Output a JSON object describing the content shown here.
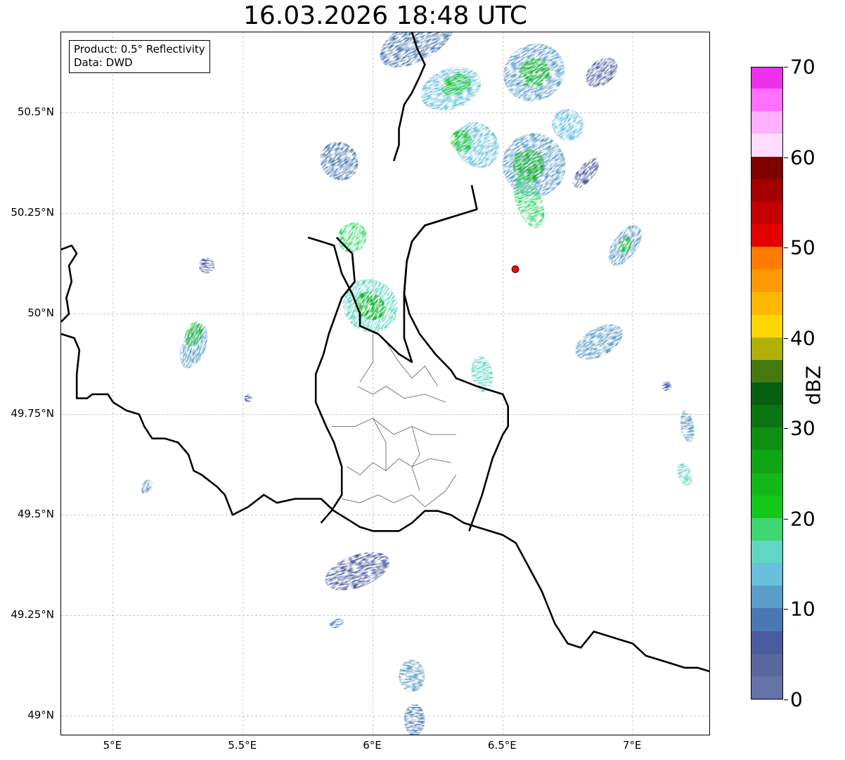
{
  "title": "16.03.2026 18:48 UTC",
  "info_box": {
    "product": "Product: 0.5° Reflectivity",
    "data": "Data: DWD"
  },
  "map": {
    "extent": {
      "lon_min": 4.8,
      "lon_max": 7.3,
      "lat_min": 48.95,
      "lat_max": 50.7
    },
    "lon_ticks": [
      {
        "value": 5.0,
        "label": "5°E"
      },
      {
        "value": 5.5,
        "label": "5.5°E"
      },
      {
        "value": 6.0,
        "label": "6°E"
      },
      {
        "value": 6.5,
        "label": "6.5°E"
      },
      {
        "value": 7.0,
        "label": "7°E"
      }
    ],
    "lat_ticks": [
      {
        "value": 50.5,
        "label": "50.5°N"
      },
      {
        "value": 50.25,
        "label": "50.25°N"
      },
      {
        "value": 50.0,
        "label": "50°N"
      },
      {
        "value": 49.75,
        "label": "49.75°N"
      },
      {
        "value": 49.5,
        "label": "49.5°N"
      },
      {
        "value": 49.25,
        "label": "49.25°N"
      },
      {
        "value": 49.0,
        "label": "49°N"
      }
    ],
    "radar_site": {
      "lon": 6.548,
      "lat": 50.111,
      "color": "#ff0000"
    },
    "country_borders": [
      [
        [
          4.8,
          50.16
        ],
        [
          4.84,
          50.17
        ],
        [
          4.86,
          50.15
        ],
        [
          4.83,
          50.12
        ],
        [
          4.84,
          50.08
        ],
        [
          4.82,
          50.04
        ],
        [
          4.83,
          50.0
        ],
        [
          4.8,
          49.98
        ]
      ],
      [
        [
          4.8,
          49.95
        ],
        [
          4.85,
          49.94
        ],
        [
          4.87,
          49.91
        ],
        [
          4.86,
          49.85
        ],
        [
          4.86,
          49.79
        ],
        [
          4.9,
          49.79
        ],
        [
          4.92,
          49.8
        ],
        [
          4.98,
          49.8
        ],
        [
          5.0,
          49.78
        ],
        [
          5.05,
          49.76
        ],
        [
          5.1,
          49.75
        ],
        [
          5.12,
          49.72
        ],
        [
          5.15,
          49.69
        ],
        [
          5.2,
          49.69
        ],
        [
          5.25,
          49.68
        ],
        [
          5.29,
          49.65
        ],
        [
          5.31,
          49.61
        ],
        [
          5.34,
          49.6
        ],
        [
          5.4,
          49.57
        ],
        [
          5.43,
          49.55
        ],
        [
          5.46,
          49.5
        ],
        [
          5.52,
          49.52
        ],
        [
          5.58,
          49.55
        ],
        [
          5.63,
          49.53
        ],
        [
          5.7,
          49.54
        ],
        [
          5.76,
          49.54
        ],
        [
          5.8,
          49.54
        ],
        [
          5.85,
          49.51
        ],
        [
          5.9,
          49.49
        ],
        [
          5.95,
          49.47
        ],
        [
          6.0,
          49.46
        ],
        [
          6.05,
          49.46
        ],
        [
          6.1,
          49.46
        ],
        [
          6.15,
          49.48
        ],
        [
          6.2,
          49.51
        ],
        [
          6.25,
          49.51
        ],
        [
          6.3,
          49.5
        ],
        [
          6.35,
          49.48
        ],
        [
          6.4,
          49.47
        ],
        [
          6.45,
          49.46
        ],
        [
          6.5,
          49.45
        ],
        [
          6.55,
          49.43
        ],
        [
          6.6,
          49.37
        ],
        [
          6.65,
          49.31
        ],
        [
          6.7,
          49.23
        ],
        [
          6.75,
          49.18
        ],
        [
          6.8,
          49.17
        ],
        [
          6.85,
          49.21
        ],
        [
          6.9,
          49.2
        ],
        [
          6.95,
          49.19
        ],
        [
          7.0,
          49.18
        ],
        [
          7.05,
          49.15
        ],
        [
          7.1,
          49.14
        ],
        [
          7.15,
          49.13
        ],
        [
          7.2,
          49.12
        ],
        [
          7.25,
          49.12
        ],
        [
          7.3,
          49.11
        ]
      ],
      [
        [
          6.38,
          50.32
        ],
        [
          6.4,
          50.26
        ],
        [
          6.3,
          50.24
        ],
        [
          6.2,
          50.22
        ],
        [
          6.15,
          50.18
        ],
        [
          6.13,
          50.13
        ],
        [
          6.12,
          50.05
        ],
        [
          6.14,
          50.0
        ],
        [
          6.18,
          49.95
        ],
        [
          6.24,
          49.9
        ],
        [
          6.3,
          49.86
        ],
        [
          6.32,
          49.84
        ],
        [
          6.4,
          49.82
        ],
        [
          6.5,
          49.8
        ],
        [
          6.52,
          49.77
        ],
        [
          6.52,
          49.72
        ],
        [
          6.5,
          49.7
        ],
        [
          6.46,
          49.64
        ],
        [
          6.42,
          49.55
        ],
        [
          6.37,
          49.46
        ]
      ],
      [
        [
          5.75,
          50.19
        ],
        [
          5.8,
          50.18
        ],
        [
          5.85,
          50.17
        ],
        [
          5.88,
          50.1
        ],
        [
          5.92,
          50.05
        ],
        [
          5.95,
          50.0
        ],
        [
          5.95,
          49.97
        ],
        [
          6.02,
          49.95
        ],
        [
          6.1,
          49.9
        ],
        [
          6.15,
          49.88
        ],
        [
          6.12,
          49.94
        ],
        [
          6.12,
          50.05
        ],
        [
          6.13,
          50.13
        ],
        [
          6.15,
          50.18
        ],
        [
          6.2,
          50.22
        ],
        [
          6.3,
          50.24
        ]
      ],
      [
        [
          5.86,
          50.19
        ],
        [
          5.92,
          50.15
        ],
        [
          5.93,
          50.08
        ],
        [
          5.88,
          50.04
        ],
        [
          5.83,
          49.95
        ],
        [
          5.81,
          49.9
        ],
        [
          5.78,
          49.85
        ],
        [
          5.78,
          49.78
        ],
        [
          5.82,
          49.72
        ],
        [
          5.85,
          49.68
        ],
        [
          5.88,
          49.62
        ],
        [
          5.88,
          49.55
        ],
        [
          5.84,
          49.51
        ],
        [
          5.8,
          49.48
        ]
      ],
      [
        [
          6.08,
          50.38
        ],
        [
          6.1,
          50.42
        ],
        [
          6.1,
          50.46
        ],
        [
          6.12,
          50.52
        ],
        [
          6.15,
          50.55
        ],
        [
          6.18,
          50.59
        ],
        [
          6.2,
          50.62
        ],
        [
          6.17,
          50.66
        ],
        [
          6.15,
          50.7
        ]
      ]
    ],
    "region_borders": [
      [
        [
          6.0,
          49.95
        ],
        [
          6.0,
          49.88
        ],
        [
          5.95,
          49.83
        ]
      ],
      [
        [
          6.05,
          49.93
        ],
        [
          6.1,
          49.88
        ],
        [
          6.15,
          49.84
        ],
        [
          6.2,
          49.87
        ],
        [
          6.25,
          49.82
        ]
      ],
      [
        [
          5.94,
          49.82
        ],
        [
          6.0,
          49.8
        ],
        [
          6.05,
          49.82
        ],
        [
          6.12,
          49.79
        ],
        [
          6.2,
          49.8
        ],
        [
          6.28,
          49.78
        ]
      ],
      [
        [
          5.84,
          49.72
        ],
        [
          5.93,
          49.72
        ],
        [
          6.0,
          49.74
        ],
        [
          6.08,
          49.7
        ],
        [
          6.15,
          49.72
        ],
        [
          6.22,
          49.7
        ],
        [
          6.32,
          49.7
        ]
      ],
      [
        [
          5.9,
          49.62
        ],
        [
          5.95,
          49.6
        ],
        [
          6.0,
          49.63
        ],
        [
          6.05,
          49.61
        ],
        [
          6.1,
          49.64
        ],
        [
          6.15,
          49.62
        ],
        [
          6.22,
          49.64
        ],
        [
          6.3,
          49.63
        ]
      ],
      [
        [
          5.88,
          49.54
        ],
        [
          5.95,
          49.53
        ],
        [
          6.02,
          49.55
        ],
        [
          6.08,
          49.53
        ],
        [
          6.15,
          49.55
        ],
        [
          6.2,
          49.52
        ],
        [
          6.28,
          49.56
        ],
        [
          6.32,
          49.6
        ]
      ],
      [
        [
          6.0,
          49.74
        ],
        [
          6.05,
          49.68
        ],
        [
          6.05,
          49.61
        ]
      ],
      [
        [
          6.15,
          49.72
        ],
        [
          6.18,
          49.65
        ],
        [
          6.15,
          49.62
        ],
        [
          6.18,
          49.56
        ]
      ]
    ]
  },
  "radar_echoes": [
    {
      "lon": 6.17,
      "lat": 50.68,
      "rx": 0.16,
      "ry": 0.05,
      "rot": -30,
      "dbz": 8
    },
    {
      "lon": 6.3,
      "lat": 50.56,
      "rx": 0.12,
      "ry": 0.05,
      "rot": -20,
      "dbz": 14
    },
    {
      "lon": 6.32,
      "lat": 50.57,
      "rx": 0.06,
      "ry": 0.025,
      "rot": -20,
      "dbz": 22
    },
    {
      "lon": 6.62,
      "lat": 50.6,
      "rx": 0.12,
      "ry": 0.07,
      "rot": -30,
      "dbz": 12
    },
    {
      "lon": 6.62,
      "lat": 50.6,
      "rx": 0.06,
      "ry": 0.035,
      "rot": -30,
      "dbz": 22
    },
    {
      "lon": 6.88,
      "lat": 50.6,
      "rx": 0.07,
      "ry": 0.03,
      "rot": -40,
      "dbz": 6
    },
    {
      "lon": 6.4,
      "lat": 50.42,
      "rx": 0.08,
      "ry": 0.06,
      "rot": -40,
      "dbz": 14
    },
    {
      "lon": 6.34,
      "lat": 50.43,
      "rx": 0.04,
      "ry": 0.03,
      "rot": -40,
      "dbz": 22
    },
    {
      "lon": 6.62,
      "lat": 50.37,
      "rx": 0.12,
      "ry": 0.08,
      "rot": -35,
      "dbz": 12
    },
    {
      "lon": 6.6,
      "lat": 50.37,
      "rx": 0.06,
      "ry": 0.04,
      "rot": -35,
      "dbz": 24
    },
    {
      "lon": 6.6,
      "lat": 50.28,
      "rx": 0.05,
      "ry": 0.07,
      "rot": -20,
      "dbz": 18
    },
    {
      "lon": 6.75,
      "lat": 50.47,
      "rx": 0.06,
      "ry": 0.04,
      "rot": -45,
      "dbz": 14
    },
    {
      "lon": 6.82,
      "lat": 50.35,
      "rx": 0.07,
      "ry": 0.02,
      "rot": -50,
      "dbz": 6
    },
    {
      "lon": 6.97,
      "lat": 50.17,
      "rx": 0.09,
      "ry": 0.03,
      "rot": -55,
      "dbz": 10
    },
    {
      "lon": 6.97,
      "lat": 50.17,
      "rx": 0.03,
      "ry": 0.015,
      "rot": -55,
      "dbz": 20
    },
    {
      "lon": 6.87,
      "lat": 49.93,
      "rx": 0.1,
      "ry": 0.035,
      "rot": -30,
      "dbz": 10
    },
    {
      "lon": 5.87,
      "lat": 50.38,
      "rx": 0.07,
      "ry": 0.05,
      "rot": -40,
      "dbz": 8
    },
    {
      "lon": 5.99,
      "lat": 50.02,
      "rx": 0.1,
      "ry": 0.07,
      "rot": -55,
      "dbz": 16
    },
    {
      "lon": 5.99,
      "lat": 50.02,
      "rx": 0.05,
      "ry": 0.04,
      "rot": -55,
      "dbz": 24
    },
    {
      "lon": 5.92,
      "lat": 50.19,
      "rx": 0.06,
      "ry": 0.035,
      "rot": -55,
      "dbz": 18
    },
    {
      "lon": 6.42,
      "lat": 49.85,
      "rx": 0.04,
      "ry": 0.045,
      "rot": -10,
      "dbz": 16
    },
    {
      "lon": 5.31,
      "lat": 49.92,
      "rx": 0.09,
      "ry": 0.03,
      "rot": -70,
      "dbz": 12
    },
    {
      "lon": 5.31,
      "lat": 49.95,
      "rx": 0.05,
      "ry": 0.02,
      "rot": -70,
      "dbz": 22
    },
    {
      "lon": 5.36,
      "lat": 50.12,
      "rx": 0.03,
      "ry": 0.02,
      "rot": 0,
      "dbz": 6
    },
    {
      "lon": 5.13,
      "lat": 49.57,
      "rx": 0.03,
      "ry": 0.012,
      "rot": -60,
      "dbz": 10
    },
    {
      "lon": 5.94,
      "lat": 49.36,
      "rx": 0.13,
      "ry": 0.04,
      "rot": -20,
      "dbz": 6
    },
    {
      "lon": 5.86,
      "lat": 49.23,
      "rx": 0.03,
      "ry": 0.01,
      "rot": -20,
      "dbz": 8
    },
    {
      "lon": 6.15,
      "lat": 49.1,
      "rx": 0.05,
      "ry": 0.04,
      "rot": 0,
      "dbz": 12
    },
    {
      "lon": 6.16,
      "lat": 48.99,
      "rx": 0.04,
      "ry": 0.04,
      "rot": 0,
      "dbz": 8
    },
    {
      "lon": 7.13,
      "lat": 49.82,
      "rx": 0.02,
      "ry": 0.012,
      "rot": -20,
      "dbz": 6
    },
    {
      "lon": 7.21,
      "lat": 49.72,
      "rx": 0.025,
      "ry": 0.04,
      "rot": -10,
      "dbz": 10
    },
    {
      "lon": 7.2,
      "lat": 49.6,
      "rx": 0.025,
      "ry": 0.03,
      "rot": -20,
      "dbz": 16
    },
    {
      "lon": 5.52,
      "lat": 49.79,
      "rx": 0.015,
      "ry": 0.01,
      "rot": 0,
      "dbz": 6
    }
  ],
  "colorbar": {
    "label": "dBZ",
    "min": 0,
    "max": 70,
    "ticks": [
      0,
      10,
      20,
      30,
      40,
      50,
      60,
      70
    ],
    "colors": [
      "#6474a6",
      "#58689e",
      "#4a5c9e",
      "#4a78b2",
      "#5b9cc8",
      "#68c0dc",
      "#62d6c4",
      "#3fd672",
      "#14c81a",
      "#12b818",
      "#10a414",
      "#0e8e12",
      "#0a7412",
      "#065e10",
      "#467810",
      "#b0b008",
      "#fcd800",
      "#fcb800",
      "#fc9800",
      "#fc7c00",
      "#e40000",
      "#c40000",
      "#a40000",
      "#800000",
      "#ffdcff",
      "#ffb0ff",
      "#ff70ff",
      "#ec30ec"
    ]
  }
}
